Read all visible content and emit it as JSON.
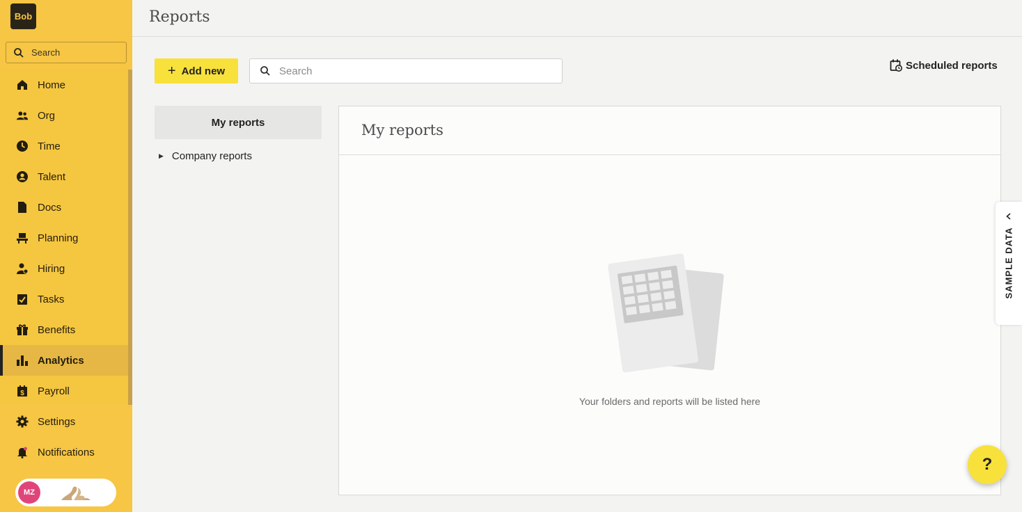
{
  "app": {
    "logo_text": "Bob"
  },
  "sidebar": {
    "search_label": "Search",
    "items": [
      {
        "label": "Home",
        "icon": "home-icon"
      },
      {
        "label": "Org",
        "icon": "people-icon"
      },
      {
        "label": "Time",
        "icon": "clock-icon"
      },
      {
        "label": "Talent",
        "icon": "talent-icon"
      },
      {
        "label": "Docs",
        "icon": "document-icon"
      },
      {
        "label": "Planning",
        "icon": "planning-icon"
      },
      {
        "label": "Hiring",
        "icon": "hiring-icon"
      },
      {
        "label": "Tasks",
        "icon": "checklist-icon"
      },
      {
        "label": "Benefits",
        "icon": "gift-icon"
      },
      {
        "label": "Analytics",
        "icon": "bar-chart-icon",
        "active": true
      },
      {
        "label": "Payroll",
        "icon": "payroll-icon"
      },
      {
        "label": "Settings",
        "icon": "gear-icon"
      },
      {
        "label": "Notifications",
        "icon": "bell-icon"
      }
    ],
    "user_initials": "MZ"
  },
  "header": {
    "title": "Reports"
  },
  "toolbar": {
    "add_label": "Add new",
    "search_placeholder": "Search",
    "scheduled_label": "Scheduled reports"
  },
  "tree": {
    "my_reports": "My reports",
    "company_reports": "Company reports"
  },
  "panel": {
    "title": "My reports",
    "empty_text": "Your folders and reports will be listed here"
  },
  "side_tab": {
    "label": "SAMPLE DATA"
  },
  "help": {
    "label": "?"
  },
  "colors": {
    "sidebar": "#f6c644",
    "accent": "#f8e13b",
    "avatar": "#e0457a"
  }
}
